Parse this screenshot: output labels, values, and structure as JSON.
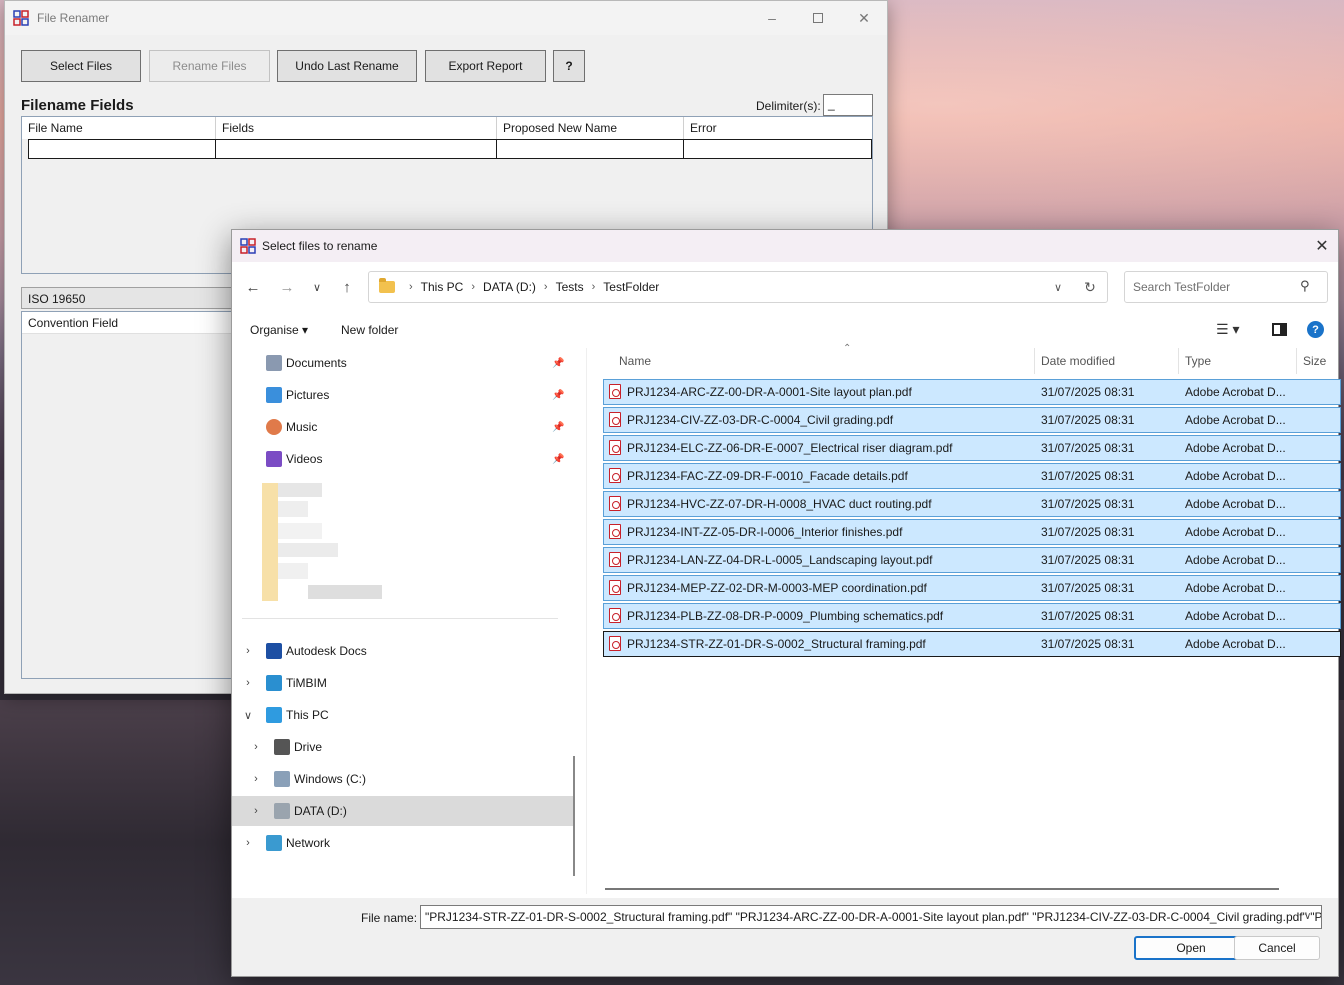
{
  "app": {
    "title": "File Renamer",
    "buttons": {
      "select_files": "Select Files",
      "rename_files": "Rename Files",
      "undo_last_rename": "Undo Last Rename",
      "export_report": "Export Report",
      "help": "?"
    },
    "section_title": "Filename Fields",
    "delimiter_label": "Delimiter(s):",
    "delimiter_value": "_",
    "grid_columns": [
      "File Name",
      "Fields",
      "Proposed New Name",
      "Error"
    ],
    "convention_selected": "ISO 19650",
    "convention_header": "Convention Field"
  },
  "dialog": {
    "title": "Select files to rename",
    "breadcrumbs": [
      "This PC",
      "DATA (D:)",
      "Tests",
      "TestFolder"
    ],
    "search_placeholder": "Search TestFolder",
    "organise_label": "Organise",
    "new_folder_label": "New folder",
    "nav_pinned": [
      {
        "label": "Documents",
        "icon": "documents-icon"
      },
      {
        "label": "Pictures",
        "icon": "pictures-icon"
      },
      {
        "label": "Music",
        "icon": "music-icon"
      },
      {
        "label": "Videos",
        "icon": "videos-icon"
      }
    ],
    "nav_tree": [
      {
        "label": "Autodesk Docs",
        "icon": "autodesk-docs-icon",
        "expander": "chevron-right"
      },
      {
        "label": "TiMBIM",
        "icon": "timbim-icon",
        "expander": "chevron-right"
      },
      {
        "label": "This PC",
        "icon": "this-pc-icon",
        "expander": "chevron-down"
      },
      {
        "label": "Drive",
        "icon": "drive-icon",
        "expander": "chevron-right"
      },
      {
        "label": "Windows (C:)",
        "icon": "windows-drive-icon",
        "expander": "chevron-right"
      },
      {
        "label": "DATA (D:)",
        "icon": "data-drive-icon",
        "expander": "chevron-right",
        "selected": true
      },
      {
        "label": "Network",
        "icon": "network-icon",
        "expander": "chevron-right"
      }
    ],
    "columns": {
      "name": "Name",
      "date_modified": "Date modified",
      "type": "Type",
      "size": "Size"
    },
    "files": [
      {
        "name": "PRJ1234-ARC-ZZ-00-DR-A-0001-Site layout plan.pdf",
        "date": "31/07/2025 08:31",
        "type": "Adobe Acrobat D..."
      },
      {
        "name": "PRJ1234-CIV-ZZ-03-DR-C-0004_Civil grading.pdf",
        "date": "31/07/2025 08:31",
        "type": "Adobe Acrobat D..."
      },
      {
        "name": "PRJ1234-ELC-ZZ-06-DR-E-0007_Electrical riser diagram.pdf",
        "date": "31/07/2025 08:31",
        "type": "Adobe Acrobat D..."
      },
      {
        "name": "PRJ1234-FAC-ZZ-09-DR-F-0010_Facade details.pdf",
        "date": "31/07/2025 08:31",
        "type": "Adobe Acrobat D..."
      },
      {
        "name": "PRJ1234-HVC-ZZ-07-DR-H-0008_HVAC duct routing.pdf",
        "date": "31/07/2025 08:31",
        "type": "Adobe Acrobat D..."
      },
      {
        "name": "PRJ1234-INT-ZZ-05-DR-I-0006_Interior finishes.pdf",
        "date": "31/07/2025 08:31",
        "type": "Adobe Acrobat D..."
      },
      {
        "name": "PRJ1234-LAN-ZZ-04-DR-L-0005_Landscaping layout.pdf",
        "date": "31/07/2025 08:31",
        "type": "Adobe Acrobat D..."
      },
      {
        "name": "PRJ1234-MEP-ZZ-02-DR-M-0003-MEP coordination.pdf",
        "date": "31/07/2025 08:31",
        "type": "Adobe Acrobat D..."
      },
      {
        "name": "PRJ1234-PLB-ZZ-08-DR-P-0009_Plumbing schematics.pdf",
        "date": "31/07/2025 08:31",
        "type": "Adobe Acrobat D..."
      },
      {
        "name": "PRJ1234-STR-ZZ-01-DR-S-0002_Structural framing.pdf",
        "date": "31/07/2025 08:31",
        "type": "Adobe Acrobat D..."
      }
    ],
    "file_name_label": "File name:",
    "file_name_value": "\"PRJ1234-STR-ZZ-01-DR-S-0002_Structural framing.pdf\" \"PRJ1234-ARC-ZZ-00-DR-A-0001-Site layout plan.pdf\" \"PRJ1234-CIV-ZZ-03-DR-C-0004_Civil grading.pdf\" \"PRJ",
    "open_label": "Open",
    "cancel_label": "Cancel"
  },
  "colors": {
    "selection_fill": "#cce8ff",
    "selection_border": "#5aa0d8",
    "accent": "#1a73c9",
    "pdf_red": "#c8212a"
  }
}
